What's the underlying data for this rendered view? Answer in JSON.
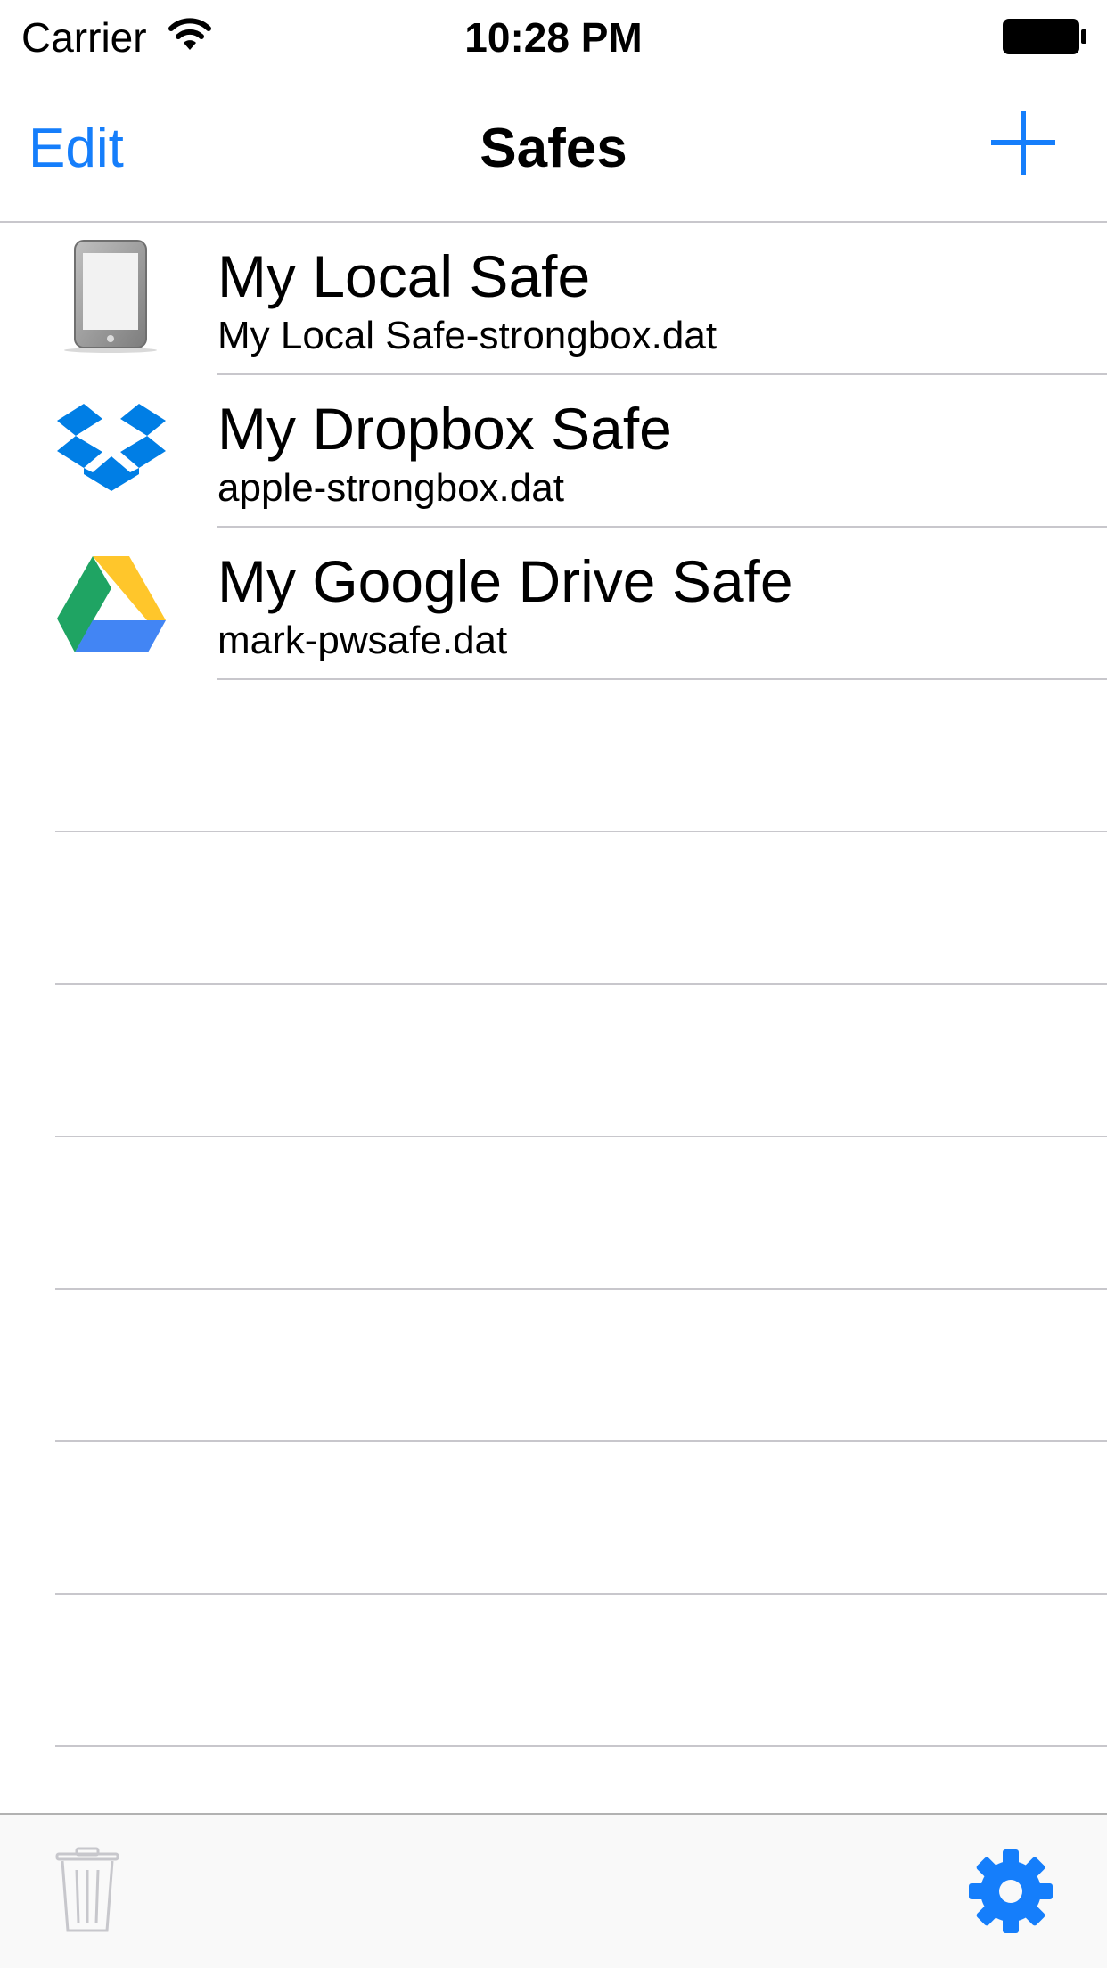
{
  "status_bar": {
    "carrier": "Carrier",
    "time": "10:28 PM",
    "wifi_icon": "wifi-icon",
    "battery_icon": "battery-icon"
  },
  "nav": {
    "left_button": "Edit",
    "title": "Safes",
    "right_button_icon": "plus-icon"
  },
  "safes": [
    {
      "title": "My Local Safe",
      "subtitle": "My Local Safe-strongbox.dat",
      "icon": "local-device-icon"
    },
    {
      "title": "My Dropbox Safe",
      "subtitle": "apple-strongbox.dat",
      "icon": "dropbox-icon"
    },
    {
      "title": "My Google Drive Safe",
      "subtitle": "mark-pwsafe.dat",
      "icon": "google-drive-icon"
    }
  ],
  "toolbar": {
    "left_icon": "trash-icon",
    "right_icon": "gear-icon"
  },
  "colors": {
    "accent": "#157efb",
    "separator": "#c8c7cc",
    "disabled": "#c7c7cc"
  }
}
